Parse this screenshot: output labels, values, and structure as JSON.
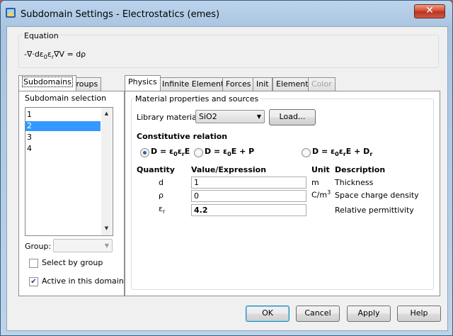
{
  "window": {
    "title": "Subdomain Settings - Electrostatics (emes)",
    "close_label": "✕"
  },
  "equation": {
    "legend": "Equation",
    "formula_parts": [
      "-∇·dε",
      "0",
      "ε",
      "r",
      "∇V = dρ"
    ]
  },
  "left_tabs": [
    {
      "label": "Subdomains",
      "active": true
    },
    {
      "label": "Groups",
      "active": false
    }
  ],
  "subdomain_selection": {
    "legend": "Subdomain selection",
    "items": [
      "1",
      "2",
      "3",
      "4"
    ],
    "selected_index": 1,
    "group_label": "Group:",
    "group_value": "",
    "select_by_group_label": "Select by group",
    "select_by_group_checked": false,
    "active_label": "Active in this domain",
    "active_checked": true
  },
  "right_tabs": [
    {
      "label": "Physics",
      "active": true,
      "disabled": false
    },
    {
      "label": "Infinite Elements",
      "active": false,
      "disabled": false
    },
    {
      "label": "Forces",
      "active": false,
      "disabled": false
    },
    {
      "label": "Init",
      "active": false,
      "disabled": false
    },
    {
      "label": "Element",
      "active": false,
      "disabled": false
    },
    {
      "label": "Color",
      "active": false,
      "disabled": true
    }
  ],
  "material": {
    "legend": "Material properties and sources",
    "library_label": "Library material:",
    "library_value": "SiO2",
    "load_label": "Load..."
  },
  "constitutive": {
    "heading": "Constitutive relation",
    "options": [
      {
        "parts": [
          "D = ε",
          "0",
          "ε",
          "r",
          "E"
        ],
        "selected": true
      },
      {
        "parts": [
          "D = ε",
          "0",
          "E + P"
        ],
        "selected": false
      },
      {
        "parts": [
          "D = ε",
          "0",
          "ε",
          "r",
          "E + D",
          "r"
        ],
        "selected": false
      }
    ]
  },
  "table": {
    "headers": {
      "quantity": "Quantity",
      "value": "Value/Expression",
      "unit": "Unit",
      "description": "Description"
    },
    "rows": [
      {
        "quantity": "d",
        "value": "1",
        "unit": "m",
        "description": "Thickness"
      },
      {
        "quantity": "ρ",
        "value": "0",
        "unit": "C/m",
        "unit_sup": "3",
        "description": "Space charge density"
      },
      {
        "quantity": "ε",
        "quantity_sub": "r",
        "value": "4.2",
        "unit": "",
        "description": "Relative permittivity"
      }
    ]
  },
  "buttons": {
    "ok": "OK",
    "cancel": "Cancel",
    "apply": "Apply",
    "help": "Help"
  },
  "colors": {
    "selection": "#3399ff",
    "background": "#d24d4d",
    "close": "#c94a2f"
  }
}
